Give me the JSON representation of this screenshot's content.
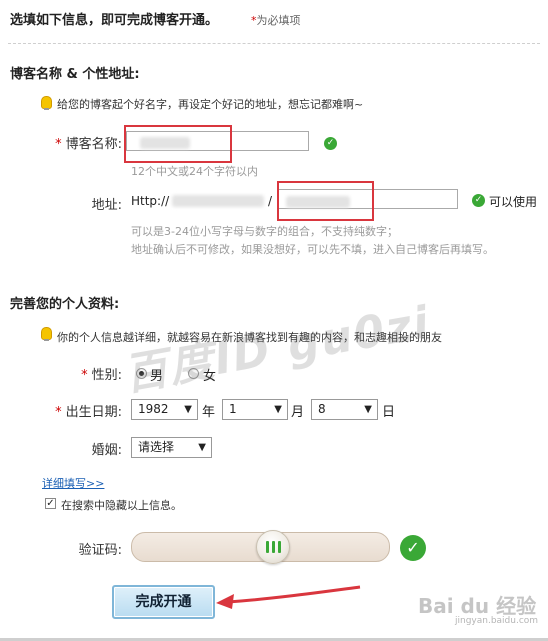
{
  "header": {
    "title": "选填如下信息，即可完成博客开通。",
    "required_mark": "*",
    "required_note": "为必填项"
  },
  "blog_section": {
    "title": "博客名称 & 个性地址:",
    "tip": "给您的博客起个好名字，再设定个好记的地址，想忘记都难啊~",
    "name_label": "博客名称:",
    "name_value": "",
    "name_hint": "12个中文或24个字符以内",
    "address_label": "地址:",
    "address_prefix": "Http://",
    "address_mid": "/",
    "address_value": "",
    "address_status": "可以使用",
    "address_hint_line1": "可以是3-24位小写字母与数字的组合，不支持纯数字；",
    "address_hint_line2": "地址确认后不可修改，如果没想好，可以先不填，进入自己博客后再填写。"
  },
  "profile_section": {
    "title": "完善您的个人资料:",
    "tip": "你的个人信息越详细，就越容易在新浪博客找到有趣的内容，和志趣相投的朋友",
    "gender_label": "性别:",
    "gender_options": [
      "男",
      "女"
    ],
    "gender_selected": "男",
    "birth_label": "出生日期:",
    "birth_year": "1982",
    "year_unit": "年",
    "birth_month": "1",
    "month_unit": "月",
    "birth_day": "8",
    "day_unit": "日",
    "marriage_label": "婚姻:",
    "marriage_value": "请选择",
    "details_link": "详细填写>>",
    "hide_checkbox_label": "在搜索中隐藏以上信息。",
    "hide_checked": true
  },
  "captcha": {
    "label": "验证码:"
  },
  "submit": {
    "label": "完成开通"
  },
  "watermark": {
    "text": "百度ID gu0zi",
    "logo_text": "Bai du 经验",
    "logo_url": "jingyan.baidu.com"
  },
  "colors": {
    "required": "#cc0000",
    "ok_green": "#3aa836",
    "highlight_red": "#d9363e",
    "link_blue": "#1a5fb4",
    "hint_gray": "#9a9a9a"
  },
  "icons": {
    "tip": "lightbulb-icon",
    "ok": "checkmark-circle-icon",
    "dropdown": "chevron-down-icon"
  }
}
